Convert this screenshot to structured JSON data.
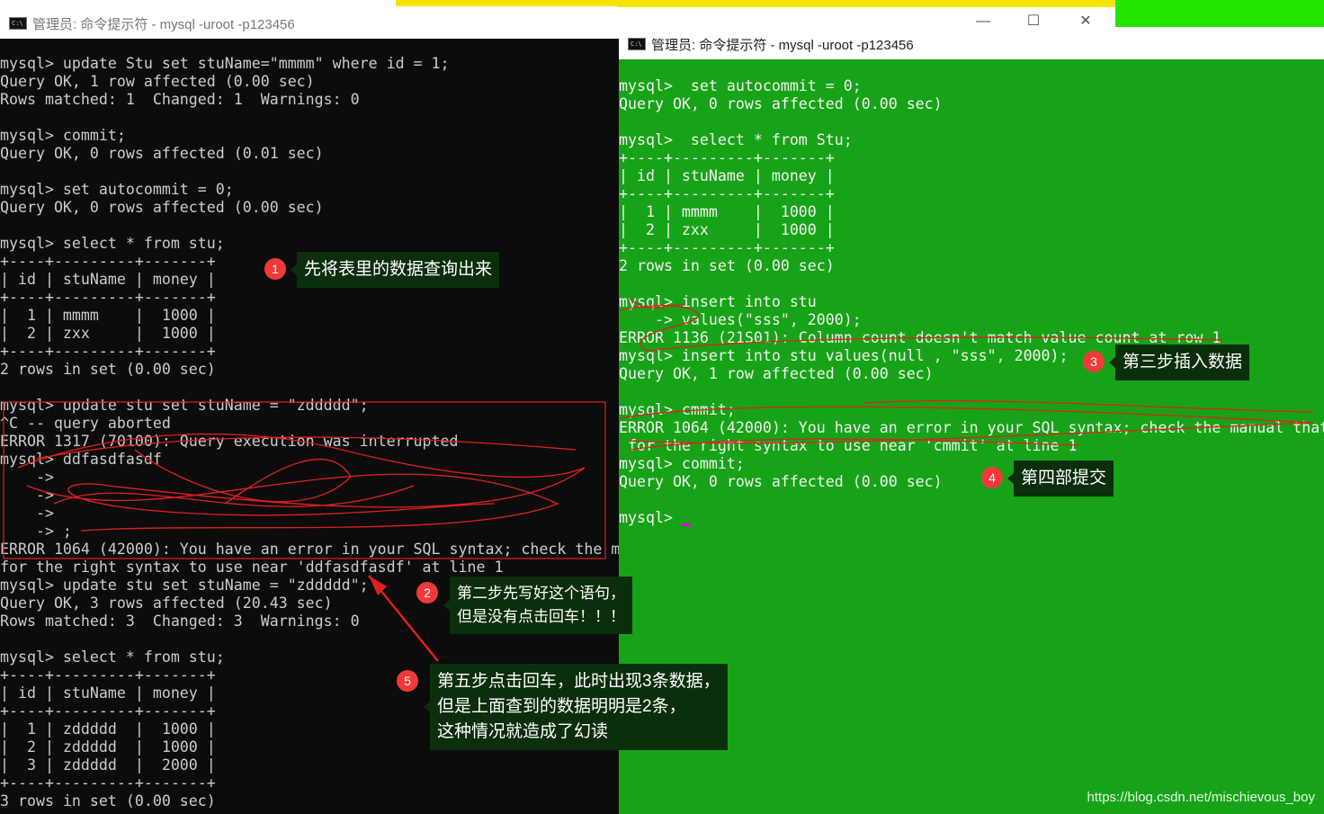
{
  "left_window": {
    "title": "管理员: 命令提示符 - mysql  -uroot -p123456",
    "console_text": "mysql> update Stu set stuName=\"mmmm\" where id = 1;\nQuery OK, 1 row affected (0.00 sec)\nRows matched: 1  Changed: 1  Warnings: 0\n\nmysql> commit;\nQuery OK, 0 rows affected (0.01 sec)\n\nmysql> set autocommit = 0;\nQuery OK, 0 rows affected (0.00 sec)\n\nmysql> select * from stu;\n+----+---------+-------+\n| id | stuName | money |\n+----+---------+-------+\n|  1 | mmmm    |  1000 |\n|  2 | zxx     |  1000 |\n+----+---------+-------+\n2 rows in set (0.00 sec)\n\nmysql> update stu set stuName = \"zddddd\";\n^C -- query aborted\nERROR 1317 (70100): Query execution was interrupted\nmysql> ddfasdfasdf\n    ->\n    ->\n    ->\n    -> ;\nERROR 1064 (42000): You have an error in your SQL syntax; check the manual\nfor the right syntax to use near 'ddfasdfasdf' at line 1\nmysql> update stu set stuName = \"zddddd\";\nQuery OK, 3 rows affected (20.43 sec)\nRows matched: 3  Changed: 3  Warnings: 0\n\nmysql> select * from stu;\n+----+---------+-------+\n| id | stuName | money |\n+----+---------+-------+\n|  1 | zddddd  |  1000 |\n|  2 | zddddd  |  1000 |\n|  3 | zddddd  |  2000 |\n+----+---------+-------+\n3 rows in set (0.00 sec)"
  },
  "right_window": {
    "title": "管理员: 命令提示符 - mysql  -uroot -p123456",
    "minimize_glyph": "—",
    "maximize_glyph": "☐",
    "close_glyph": "✕",
    "console_text": "mysql>  set autocommit = 0;\nQuery OK, 0 rows affected (0.00 sec)\n\nmysql>  select * from Stu;\n+----+---------+-------+\n| id | stuName | money |\n+----+---------+-------+\n|  1 | mmmm    |  1000 |\n|  2 | zxx     |  1000 |\n+----+---------+-------+\n2 rows in set (0.00 sec)\n\nmysql> insert into stu\n    -> values(\"sss\", 2000);\nERROR 1136 (21S01): Column count doesn't match value count at row 1\nmysql> insert into stu values(null , \"sss\", 2000);\nQuery OK, 1 row affected (0.00 sec)\n\nmysql> cmmit;\nERROR 1064 (42000): You have an error in your SQL syntax; check the manual that\n for the right syntax to use near 'cmmit' at line 1\nmysql> commit;\nQuery OK, 0 rows affected (0.00 sec)\n\nmysql> "
  },
  "annotations": [
    {
      "number": "1",
      "text": "先将表里的数据查询出来"
    },
    {
      "number": "2",
      "text": "第二步先写好这个语句，\n但是没有点击回车！！！"
    },
    {
      "number": "3",
      "text": "第三步插入数据"
    },
    {
      "number": "4",
      "text": "第四部提交"
    },
    {
      "number": "5",
      "text": "第五步点击回车，此时出现3条数据，\n但是上面查到的数据明明是2条，\n这种情况就造成了幻读"
    }
  ],
  "watermark": "https://blog.csdn.net/mischievous_boy",
  "colors": {
    "left_console_bg": "#0c0c0c",
    "right_console_bg": "#17a317",
    "annotation_bg": "#0b2e0b",
    "badge": "#f03a3a",
    "scribble": "#e02020"
  },
  "icons": [
    "cmd-icon",
    "minimize-icon",
    "maximize-icon",
    "close-icon",
    "cursor"
  ]
}
